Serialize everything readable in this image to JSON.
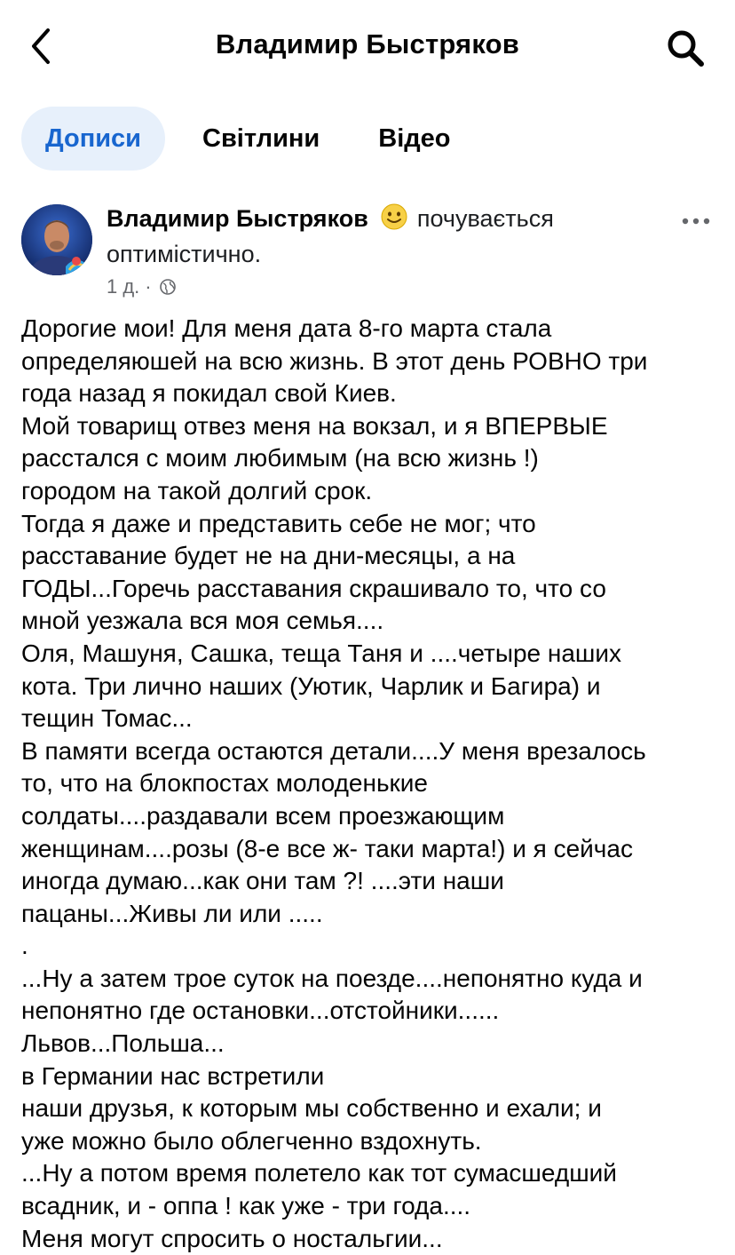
{
  "header": {
    "title": "Владимир Быстряков",
    "back_icon": "chevron-left-icon",
    "search_icon": "search-icon"
  },
  "tabs": [
    {
      "label": "Дописи",
      "active": true
    },
    {
      "label": "Світлини",
      "active": false
    },
    {
      "label": "Відео",
      "active": false
    }
  ],
  "post": {
    "author": "Владимир Быстряков",
    "feeling_icon": "smiling-face-icon",
    "feeling_text": "почувається оптимістично.",
    "time": "1 д.",
    "separator": "·",
    "privacy_icon": "globe-icon",
    "more_icon": "more-horizontal-icon",
    "body_lines": [
      "Дорогие мои! Для меня дата 8-го марта стала",
      "определяюшей на всю жизнь. В этот день РОВНО три",
      "года назад я покидал свой Киев.",
      "Мой товарищ отвез меня на вокзал, и я ВПЕРВЫЕ",
      "расстался с моим любимым (на всю жизнь !)",
      "городом на такой долгий срок.",
      "Тогда я даже и представить себе не мог; что",
      "расставание будет не на дни-месяцы, а на",
      "ГОДЫ...Горечь расставания скрашивало то, что со",
      "мной уезжала вся моя семья....",
      "Оля, Машуня, Сашка, теща Таня и ....четыре наших",
      "кота. Три лично наших (Уютик, Чарлик и Багира) и",
      "тещин Томас...",
      "В памяти всегда остаются детали....У меня врезалось",
      "то, что на блокпостах молоденькие",
      "солдаты....раздавали всем проезжающим",
      "женщинам....розы (8-е все ж- таки марта!) и я сейчас",
      "иногда думаю...как они там ?! ....эти наши",
      "пацаны...Живы ли или .....",
      ".",
      "...Ну а затем трое суток на поезде....непонятно куда и",
      "непонятно где остановки...отстойники......",
      "Львов...Польша...",
      "в Германии нас встретили",
      "наши друзья, к которым мы собственно и ехали; и",
      "уже можно было облегченно вздохнуть.",
      "...Ну а потом время полетело как тот сумасшедший",
      "всадник, и - оппа ! как уже - три года....",
      "Меня могут спросить о ностальгии..."
    ]
  }
}
